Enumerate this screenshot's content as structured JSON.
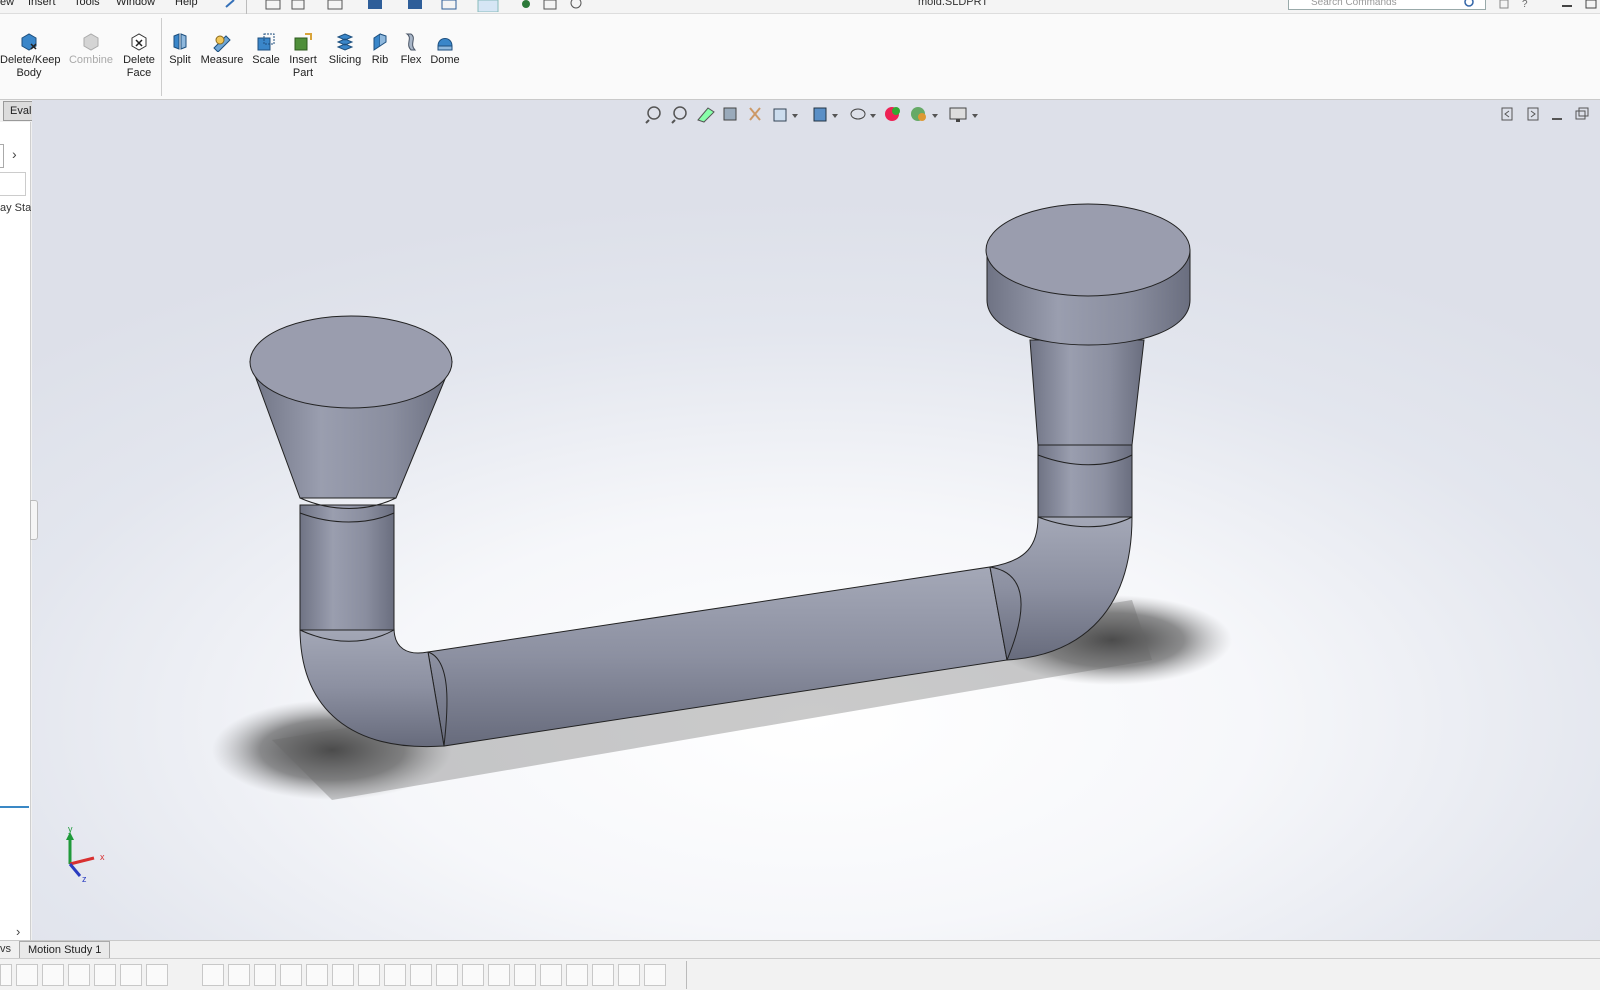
{
  "menubar": {
    "items": [
      "ew",
      "Insert",
      "Tools",
      "Window",
      "Help"
    ],
    "title": "mold.SLDPRT",
    "search_placeholder": "Search Commands"
  },
  "ribbon": {
    "buttons": [
      {
        "label": "Delete/Keep",
        "label2": "Body",
        "icon": "delete-keep-body-icon",
        "enabled": true
      },
      {
        "label": "Combine",
        "label2": "",
        "icon": "combine-icon",
        "enabled": false
      },
      {
        "label": "Delete",
        "label2": "Face",
        "icon": "delete-face-icon",
        "enabled": true
      },
      {
        "label": "Split",
        "label2": "",
        "icon": "split-icon",
        "enabled": true
      },
      {
        "label": "Measure",
        "label2": "",
        "icon": "measure-icon",
        "enabled": true
      },
      {
        "label": "Scale",
        "label2": "",
        "icon": "scale-icon",
        "enabled": true
      },
      {
        "label": "Insert",
        "label2": "Part",
        "icon": "insert-part-icon",
        "enabled": true
      },
      {
        "label": "Slicing",
        "label2": "",
        "icon": "slicing-icon",
        "enabled": true
      },
      {
        "label": "Rib",
        "label2": "",
        "icon": "rib-icon",
        "enabled": true
      },
      {
        "label": "Flex",
        "label2": "",
        "icon": "flex-icon",
        "enabled": true
      },
      {
        "label": "Dome",
        "label2": "",
        "icon": "dome-icon",
        "enabled": true
      }
    ]
  },
  "tabs": {
    "evaluate": "Evaluate"
  },
  "leftpanel": {
    "truncated_text": "ay Sta"
  },
  "triad": {
    "x": "x",
    "y": "y",
    "z": "z"
  },
  "bottom": {
    "tab_truncated": "vs",
    "motion_study": "Motion Study 1"
  },
  "colors": {
    "accent": "#3a88c5",
    "model": "#8f93a3",
    "model_dark": "#6b6f80",
    "model_light": "#a9adbc"
  }
}
